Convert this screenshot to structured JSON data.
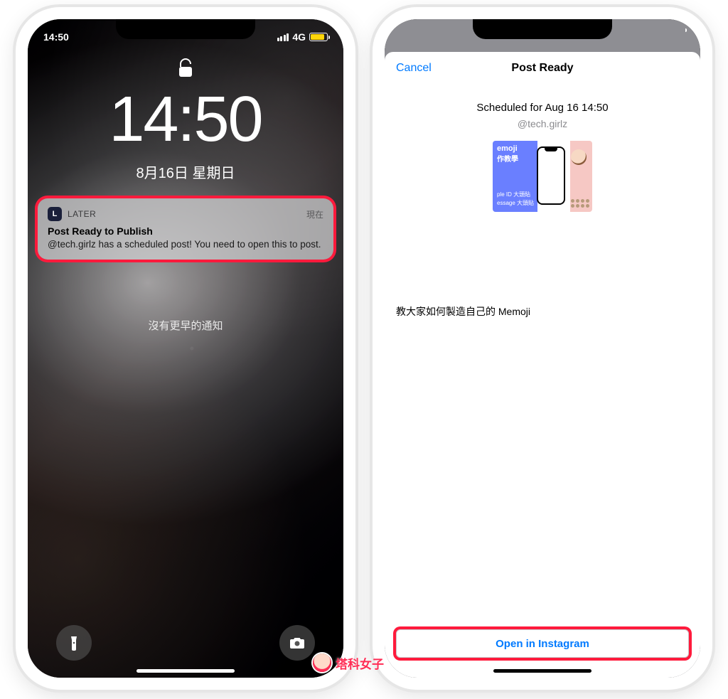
{
  "left": {
    "status": {
      "time": "14:50",
      "network": "4G"
    },
    "clock": "14:50",
    "date": "8月16日 星期日",
    "notification": {
      "app": "LATER",
      "when": "現在",
      "title": "Post Ready to Publish",
      "body": "@tech.girlz has a scheduled post! You need to open this to post."
    },
    "no_more": "沒有更早的通知"
  },
  "right": {
    "nav": {
      "cancel": "Cancel",
      "title": "Post Ready"
    },
    "scheduled": "Scheduled for Aug 16 14:50",
    "handle": "@tech.girlz",
    "thumb": {
      "headline": "emoji",
      "sub1": "作教學",
      "line1": "ple ID 大頭貼",
      "line2": "essage 大頭貼"
    },
    "caption": "教大家如何製造自己的 Memoji",
    "cta": "Open in Instagram"
  },
  "watermark": "塔科女子"
}
